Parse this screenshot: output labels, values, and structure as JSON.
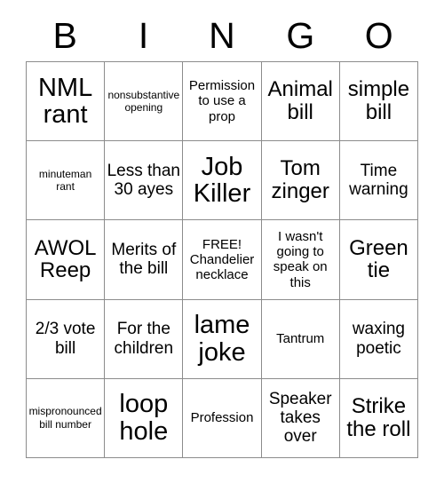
{
  "card": {
    "title_letters": [
      "B",
      "I",
      "N",
      "G",
      "O"
    ],
    "columns": 5,
    "rows": 5,
    "border_color": "#8c8c8c",
    "text_color": "#000000",
    "background_color": "#ffffff",
    "cells": [
      [
        {
          "text": "NML rant",
          "size": "xl"
        },
        {
          "text": "nonsubstantive opening",
          "size": "xs"
        },
        {
          "text": "Permission to use a prop",
          "size": "sm"
        },
        {
          "text": "Animal bill",
          "size": "lg"
        },
        {
          "text": "simple bill",
          "size": "lg"
        }
      ],
      [
        {
          "text": "minuteman rant",
          "size": "xs"
        },
        {
          "text": "Less than 30 ayes",
          "size": "md"
        },
        {
          "text": "Job Killer",
          "size": "xl"
        },
        {
          "text": "Tom zinger",
          "size": "lg"
        },
        {
          "text": "Time warning",
          "size": "md"
        }
      ],
      [
        {
          "text": "AWOL Reep",
          "size": "lg"
        },
        {
          "text": "Merits of the bill",
          "size": "md"
        },
        {
          "text": "FREE! Chandelier necklace",
          "size": "sm"
        },
        {
          "text": "I wasn't going to speak on this",
          "size": "sm"
        },
        {
          "text": "Green tie",
          "size": "lg"
        }
      ],
      [
        {
          "text": "2/3 vote bill",
          "size": "md"
        },
        {
          "text": "For the children",
          "size": "md"
        },
        {
          "text": "lame joke",
          "size": "xl"
        },
        {
          "text": "Tantrum",
          "size": "sm"
        },
        {
          "text": "waxing poetic",
          "size": "md"
        }
      ],
      [
        {
          "text": "mispronounced bill number",
          "size": "xs"
        },
        {
          "text": "loop hole",
          "size": "xl"
        },
        {
          "text": "Profession",
          "size": "sm"
        },
        {
          "text": "Speaker takes over",
          "size": "md"
        },
        {
          "text": "Strike the roll",
          "size": "lg"
        }
      ]
    ]
  }
}
